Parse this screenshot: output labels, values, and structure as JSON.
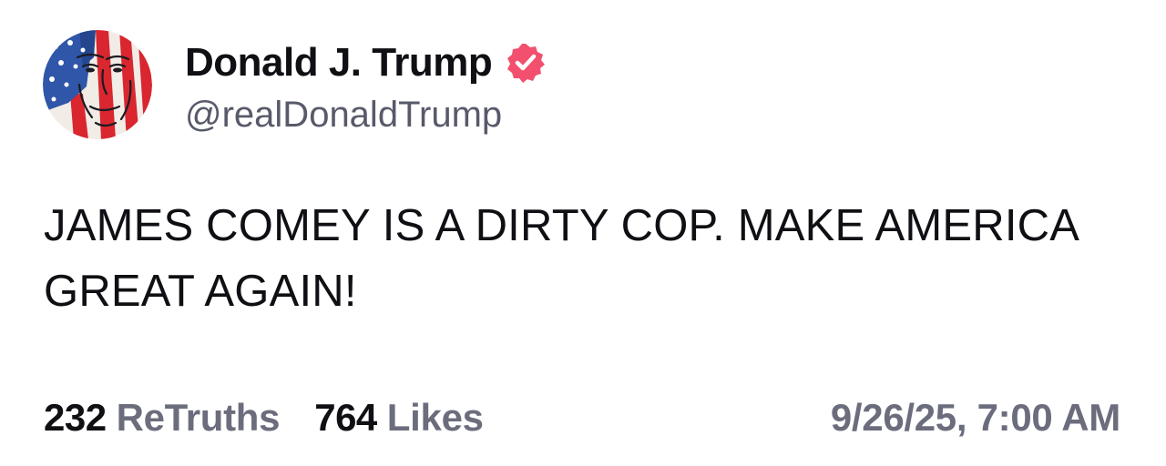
{
  "author": {
    "display_name": "Donald J. Trump",
    "handle": "@realDonaldTrump",
    "verified_icon": "verified-badge-icon",
    "avatar_icon": "avatar-image"
  },
  "post": {
    "text": "JAMES COMEY IS A DIRTY COP. MAKE AMERICA GREAT AGAIN!"
  },
  "stats": {
    "retruths_count": "232",
    "retruths_label": "ReTruths",
    "likes_count": "764",
    "likes_label": "Likes"
  },
  "timestamp": "9/26/25, 7:00 AM",
  "colors": {
    "text_primary": "#0f0f14",
    "text_secondary": "#6b6d7d",
    "verified_badge": "#f2506e"
  }
}
